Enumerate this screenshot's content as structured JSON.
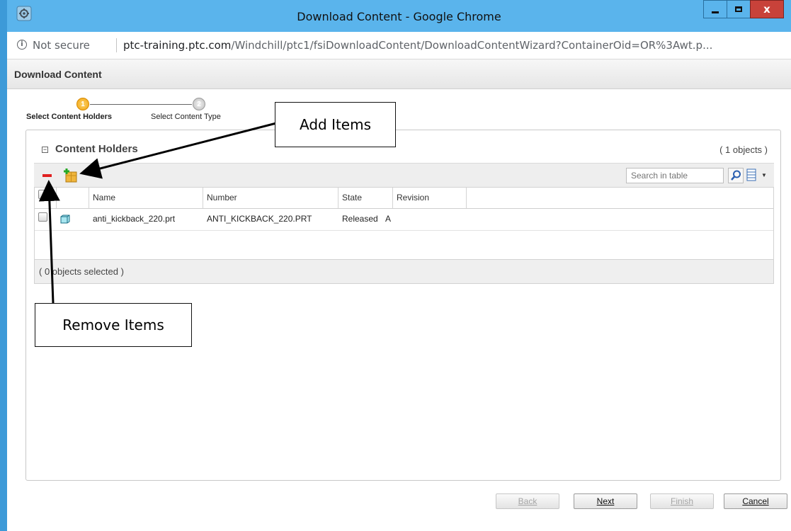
{
  "window": {
    "title": "Download Content - Google Chrome",
    "minimize_glyph": "",
    "maximize_glyph": "",
    "close_glyph": "x"
  },
  "address_bar": {
    "info_glyph": "i",
    "security_label": "Not secure",
    "url_host": "ptc-training.ptc.com",
    "url_path": "/Windchill/ptc1/fsiDownloadContent/DownloadContentWizard?ContainerOid=OR%3Awt.p..."
  },
  "page": {
    "title": "Download Content"
  },
  "wizard": {
    "steps": [
      {
        "number": "1",
        "label": "Select Content Holders",
        "active": true
      },
      {
        "number": "2",
        "label": "Select Content Type",
        "active": false
      }
    ]
  },
  "panel": {
    "collapse_glyph": "−",
    "title": "Content Holders",
    "object_count": "( 1 objects )",
    "search": {
      "placeholder": "Search in table",
      "value": "Search in table"
    },
    "dropdown_glyph": "▼",
    "columns": [
      "Name",
      "Number",
      "State",
      "Revision"
    ],
    "rows": [
      {
        "name": "anti_kickback_220.prt",
        "number": "ANTI_KICKBACK_220.PRT",
        "state": "Released",
        "revision": "A"
      }
    ],
    "selection_status": "( 0 objects selected )"
  },
  "buttons": {
    "back": "Back",
    "next": "Next",
    "finish": "Finish",
    "cancel": "Cancel"
  },
  "annotations": {
    "add_items": "Add Items",
    "remove_items": "Remove Items"
  },
  "colors": {
    "titlebar": "#5ab4ec",
    "close_button": "#c8423a",
    "step_active": "#f1a20f",
    "remove_icon": "#e02020"
  },
  "icons": {
    "app": "chrome-window-icon",
    "remove": "remove-minus-icon",
    "add": "add-items-icon",
    "search": "magnifier-icon",
    "columns": "table-columns-icon",
    "part": "part-cube-icon"
  }
}
